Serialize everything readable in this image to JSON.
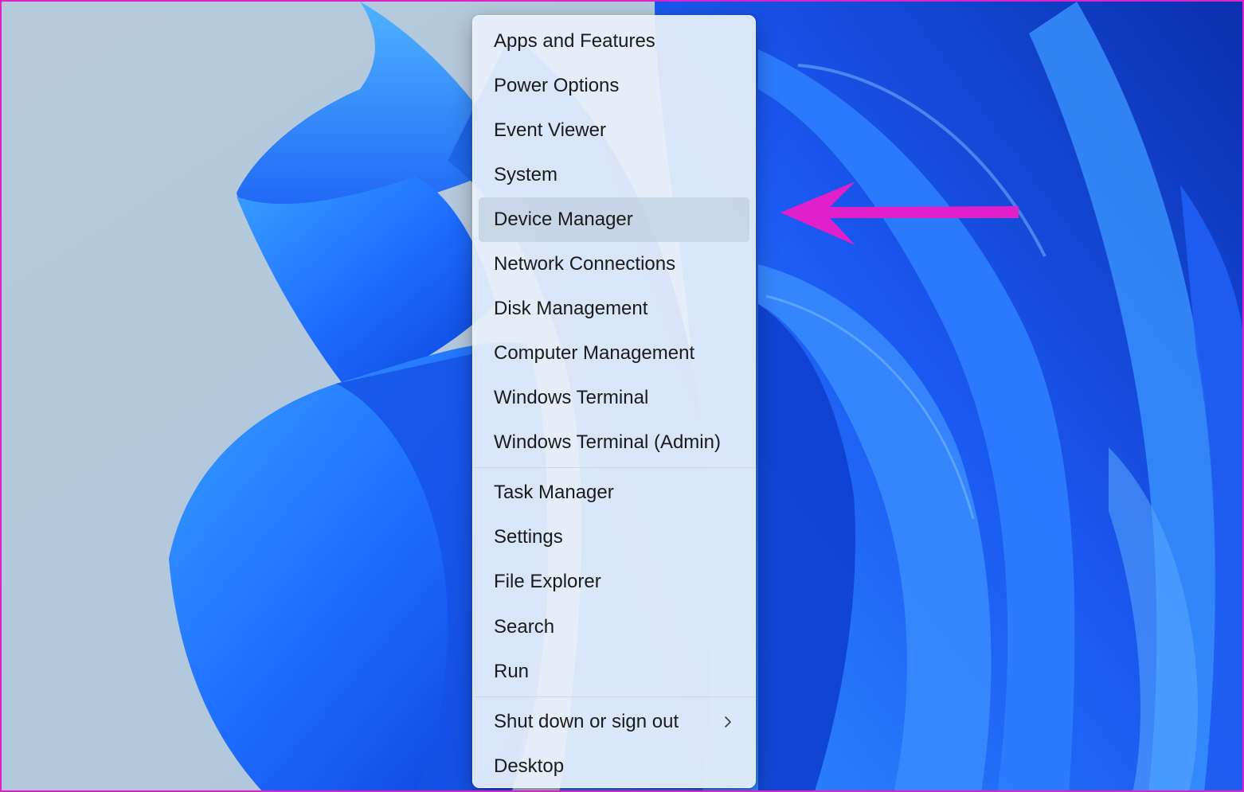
{
  "colors": {
    "annotation_arrow": "#e11fcb",
    "frame_border": "#e020c8",
    "menu_background": "#e8f0fa",
    "selected_item": "#c4d2e4",
    "desktop_gray": "#b3c9dd",
    "bloom_blue": "#1f6bff"
  },
  "menu": {
    "group_system": [
      {
        "label": "Apps and Features"
      },
      {
        "label": "Power Options"
      },
      {
        "label": "Event Viewer"
      },
      {
        "label": "System"
      },
      {
        "label": "Device Manager",
        "selected": true
      },
      {
        "label": "Network Connections"
      },
      {
        "label": "Disk Management"
      },
      {
        "label": "Computer Management"
      },
      {
        "label": "Windows Terminal"
      },
      {
        "label": "Windows Terminal (Admin)"
      }
    ],
    "group_tools": [
      {
        "label": "Task Manager"
      },
      {
        "label": "Settings"
      },
      {
        "label": "File Explorer"
      },
      {
        "label": "Search"
      },
      {
        "label": "Run"
      }
    ],
    "group_power": [
      {
        "label": "Shut down or sign out",
        "submenu_icon": "chevron-right-icon"
      },
      {
        "label": "Desktop"
      }
    ]
  }
}
